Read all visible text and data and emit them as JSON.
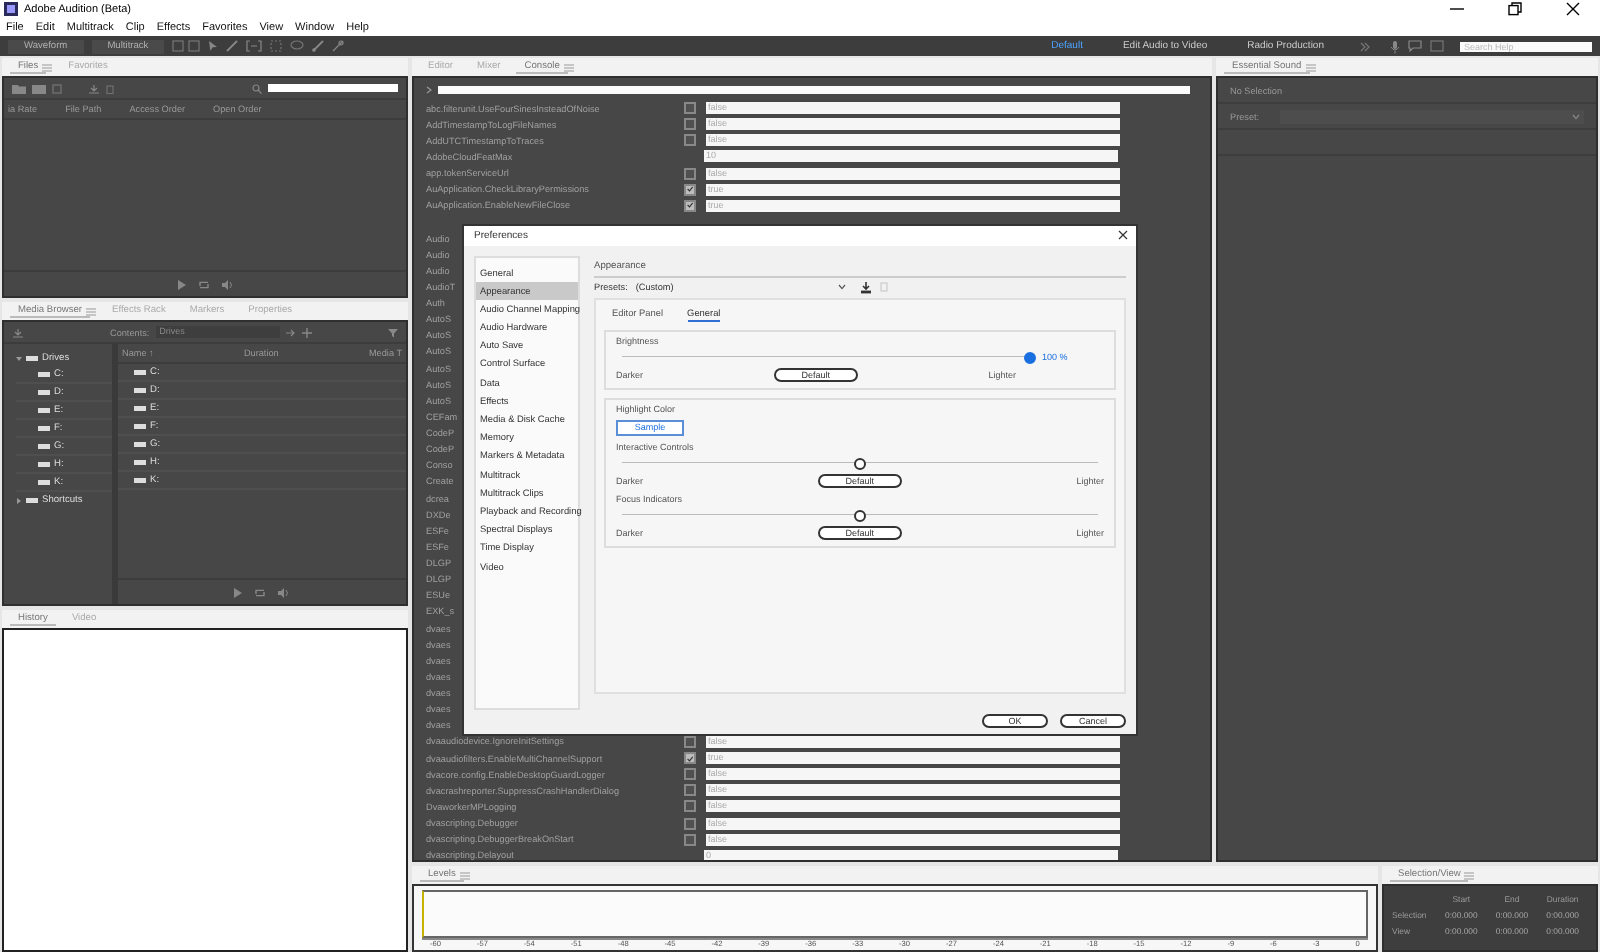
{
  "window": {
    "title": "Adobe Audition (Beta)"
  },
  "menu": [
    "File",
    "Edit",
    "Multitrack",
    "Clip",
    "Effects",
    "Favorites",
    "View",
    "Window",
    "Help"
  ],
  "toolbar": {
    "views": [
      {
        "label": "Waveform",
        "selected": false
      },
      {
        "label": "Multitrack",
        "selected": false
      }
    ],
    "workspaces": [
      {
        "label": "Default",
        "selected": true
      },
      {
        "label": "Edit Audio to Video",
        "selected": false
      },
      {
        "label": "Radio Production",
        "selected": false
      }
    ],
    "search": {
      "placeholder": "Search Help"
    }
  },
  "files_panel": {
    "tabs": [
      {
        "label": "Files",
        "selected": true
      },
      {
        "label": "Favorites",
        "selected": false
      }
    ],
    "columns": [
      "ia Rate",
      "File Path",
      "Access Order",
      "Open Order"
    ]
  },
  "media_browser": {
    "tabs": [
      {
        "label": "Media Browser",
        "selected": true
      },
      {
        "label": "Effects Rack",
        "selected": false
      },
      {
        "label": "Markers",
        "selected": false
      },
      {
        "label": "Properties",
        "selected": false
      }
    ],
    "contents_label": "Contents:",
    "contents_value": "Drives",
    "tree": [
      {
        "label": "Drives",
        "expanded": true,
        "children": [
          {
            "label": "C:"
          },
          {
            "label": "D:"
          },
          {
            "label": "E:"
          },
          {
            "label": "F:"
          },
          {
            "label": "G:"
          },
          {
            "label": "H:"
          },
          {
            "label": "K:"
          }
        ]
      },
      {
        "label": "Shortcuts",
        "expanded": false
      }
    ],
    "columns": [
      "Name ↑",
      "Duration",
      "Media T"
    ],
    "rows": [
      "C:",
      "D:",
      "E:",
      "F:",
      "G:",
      "H:",
      "K:"
    ]
  },
  "history_panel": {
    "tabs": [
      {
        "label": "History",
        "selected": true
      },
      {
        "label": "Video",
        "selected": false
      }
    ]
  },
  "editor_panel": {
    "tabs": [
      {
        "label": "Editor",
        "selected": false
      },
      {
        "label": "Mixer",
        "selected": false
      },
      {
        "label": "Console",
        "selected": true
      }
    ],
    "rows": [
      {
        "kind": "checkbox",
        "name": "abc.filterunit.UseFourSinesInsteadOfNoise",
        "checked": false,
        "value": "false"
      },
      {
        "kind": "checkbox",
        "name": "AddTimestampToLogFileNames",
        "checked": false,
        "value": "false"
      },
      {
        "kind": "checkbox",
        "name": "AddUTCTimestampToTraces",
        "checked": false,
        "value": "false"
      },
      {
        "kind": "text",
        "name": "AdobeCloudFeatMax",
        "value": "10"
      },
      {
        "kind": "checkbox",
        "name": "app.tokenServiceUrl",
        "checked": false,
        "value": "false"
      },
      {
        "kind": "checkbox",
        "name": "AuApplication.CheckLibraryPermissions",
        "checked": true,
        "value": "true"
      },
      {
        "kind": "checkbox",
        "name": "AuApplication.EnableNewFileClose",
        "checked": true,
        "value": "true"
      },
      {
        "kind": "covered",
        "name": "Audio"
      },
      {
        "kind": "covered",
        "name": "Audio"
      },
      {
        "kind": "covered",
        "name": "Audio"
      },
      {
        "kind": "covered",
        "name": "AudioT"
      },
      {
        "kind": "covered",
        "name": "Auth"
      },
      {
        "kind": "covered",
        "name": "AutoS"
      },
      {
        "kind": "covered",
        "name": "AutoS"
      },
      {
        "kind": "covered",
        "name": "AutoS"
      },
      {
        "kind": "covered",
        "name": "AutoS"
      },
      {
        "kind": "covered",
        "name": "AutoS"
      },
      {
        "kind": "covered",
        "name": "AutoS"
      },
      {
        "kind": "covered",
        "name": "CEFam"
      },
      {
        "kind": "covered",
        "name": "CodeP"
      },
      {
        "kind": "covered",
        "name": "CodeP"
      },
      {
        "kind": "covered",
        "name": "Conso"
      },
      {
        "kind": "covered",
        "name": "Create"
      },
      {
        "kind": "covered",
        "name": "dcrea"
      },
      {
        "kind": "covered",
        "name": "DXDe"
      },
      {
        "kind": "covered",
        "name": "ESFe"
      },
      {
        "kind": "covered",
        "name": "ESFe"
      },
      {
        "kind": "covered",
        "name": "DLGP"
      },
      {
        "kind": "covered",
        "name": "DLGP"
      },
      {
        "kind": "covered",
        "name": "ESUe"
      },
      {
        "kind": "covered",
        "name": "EXK_s"
      },
      {
        "kind": "covered",
        "name": "dvaes"
      },
      {
        "kind": "covered",
        "name": "dvaes"
      },
      {
        "kind": "covered",
        "name": "dvaes"
      },
      {
        "kind": "covered",
        "name": "dvaes"
      },
      {
        "kind": "covered",
        "name": "dvaes"
      },
      {
        "kind": "covered",
        "name": "dvaes"
      },
      {
        "kind": "covered",
        "name": "dvaes"
      },
      {
        "kind": "checkbox",
        "name": "dvaaudiodevice.IgnoreInitSettings",
        "checked": false,
        "value": "false"
      },
      {
        "kind": "checkbox",
        "name": "dvaaudiofilters.EnableMultiChannelSupport",
        "checked": true,
        "value": "true"
      },
      {
        "kind": "checkbox",
        "name": "dvacore.config.EnableDesktopGuardLogger",
        "checked": false,
        "value": "false"
      },
      {
        "kind": "checkbox",
        "name": "dvacrashreporter.SuppressCrashHandlerDialog",
        "checked": false,
        "value": "false"
      },
      {
        "kind": "checkbox",
        "name": "DvaworkerMPLogging",
        "checked": false,
        "value": "false"
      },
      {
        "kind": "checkbox",
        "name": "dvascripting.Debugger",
        "checked": false,
        "value": "false"
      },
      {
        "kind": "checkbox",
        "name": "dvascripting.DebuggerBreakOnStart",
        "checked": false,
        "value": "false"
      },
      {
        "kind": "text",
        "name": "dvascripting.Delayout",
        "value": "0"
      }
    ]
  },
  "essential_sound": {
    "tabs": [
      {
        "label": "Essential Sound",
        "selected": true
      }
    ],
    "status": "No Selection",
    "preset_label": "Preset:"
  },
  "levels": {
    "tabs": [
      {
        "label": "Levels",
        "selected": true
      }
    ],
    "scale": [
      "-60",
      "-57",
      "-54",
      "-51",
      "-48",
      "-45",
      "-42",
      "-39",
      "-36",
      "-33",
      "-30",
      "-27",
      "-24",
      "-21",
      "-18",
      "-15",
      "-12",
      "-9",
      "-6",
      "-3",
      "0"
    ]
  },
  "selection_view": {
    "tabs": [
      {
        "label": "Selection/View",
        "selected": true
      }
    ],
    "columns": [
      "Start",
      "End",
      "Duration"
    ],
    "rows": [
      {
        "label": "Selection",
        "values": [
          "0:00.000",
          "0:00.000",
          "0:00.000"
        ]
      },
      {
        "label": "View",
        "values": [
          "0:00.000",
          "0:00.000",
          "0:00.000"
        ]
      }
    ]
  },
  "dialog": {
    "title": "Preferences",
    "categories": [
      {
        "label": "General",
        "selected": false
      },
      {
        "label": "Appearance",
        "selected": true
      },
      {
        "label": "Audio Channel Mapping",
        "selected": false
      },
      {
        "label": "Audio Hardware",
        "selected": false
      },
      {
        "label": "Auto Save",
        "selected": false
      },
      {
        "label": "Control Surface",
        "selected": false
      },
      {
        "label": "Data",
        "selected": false
      },
      {
        "label": "Effects",
        "selected": false
      },
      {
        "label": "Media & Disk Cache",
        "selected": false
      },
      {
        "label": "Memory",
        "selected": false
      },
      {
        "label": "Markers & Metadata",
        "selected": false
      },
      {
        "label": "Multitrack",
        "selected": false
      },
      {
        "label": "Multitrack Clips",
        "selected": false
      },
      {
        "label": "Playback and Recording",
        "selected": false
      },
      {
        "label": "Spectral Displays",
        "selected": false
      },
      {
        "label": "Time Display",
        "selected": false
      },
      {
        "label": "Video",
        "selected": false
      }
    ],
    "heading": "Appearance",
    "presets_label": "Presets:",
    "presets_value": "(Custom)",
    "tabs": [
      {
        "label": "Editor Panel",
        "selected": false
      },
      {
        "label": "General",
        "selected": true
      }
    ],
    "brightness": {
      "title": "Brightness",
      "level": 1.0,
      "reading": "100 %",
      "left": "Darker",
      "button": "Default",
      "right": "Lighter"
    },
    "highlight": {
      "title": "Highlight Color",
      "sample": "Sample",
      "sliders": [
        {
          "title": "Interactive Controls",
          "level": 0.5,
          "left": "Darker",
          "button": "Default",
          "right": "Lighter"
        },
        {
          "title": "Focus Indicators",
          "level": 0.5,
          "left": "Darker",
          "button": "Default",
          "right": "Lighter"
        }
      ]
    },
    "buttons": [
      "OK",
      "Cancel"
    ]
  }
}
